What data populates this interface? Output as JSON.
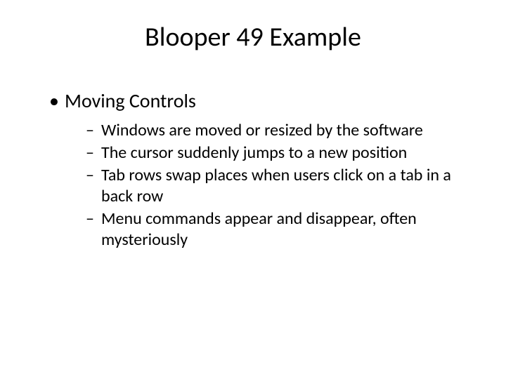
{
  "title": "Blooper 49 Example",
  "bullet": {
    "label": "Moving Controls",
    "items": [
      "Windows are moved or resized by the software",
      "The cursor suddenly jumps to a new position",
      "Tab rows swap places when users click on a tab in a back row",
      "Menu commands appear and disappear, often mysteriously"
    ]
  }
}
